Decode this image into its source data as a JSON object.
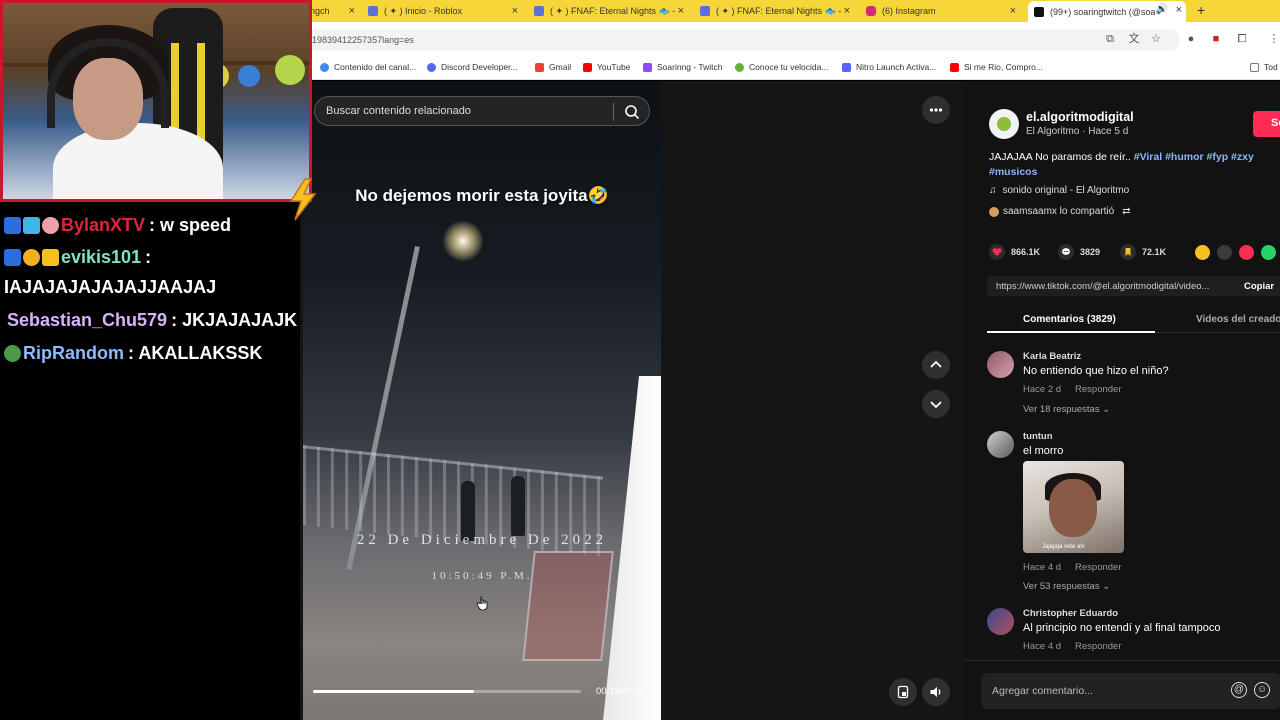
{
  "browser": {
    "tabs": [
      {
        "title": "ngch",
        "active": false
      },
      {
        "title": "( ✦ ) Inicio - Roblox",
        "active": false
      },
      {
        "title": "( ✦ ) FNAF: Eternal Nights 🐟 -",
        "active": false
      },
      {
        "title": "( ✦ ) FNAF: Eternal Nights 🐟 -",
        "active": false
      },
      {
        "title": "(6) Instagram",
        "active": false
      },
      {
        "title": "(99+) soaringtwitch (@soa",
        "active": true
      }
    ],
    "url": "19839412257357lang=es",
    "bookmarks": [
      {
        "label": "Contenido del canal...",
        "color": "#4285f4"
      },
      {
        "label": "Discord Developer...",
        "color": "#5865f2"
      },
      {
        "label": "Gmail",
        "color": "#ea4335"
      },
      {
        "label": "YouTube",
        "color": "#ff0000"
      },
      {
        "label": "Soarinng - Twitch",
        "color": "#9146ff"
      },
      {
        "label": "Conoce tu velocida...",
        "color": "#5fb236"
      },
      {
        "label": "Nitro Launch Activa...",
        "color": "#5865f2"
      },
      {
        "label": "Si me Rio, Compro...",
        "color": "#ff0000"
      },
      {
        "label": "Tod",
        "color": "#777777"
      }
    ]
  },
  "tiktok": {
    "search_placeholder": "Buscar contenido relacionado",
    "video": {
      "caption": "No dejemos morir esta joyita🤣",
      "date_overlay": "22 De Diciembre De 2022",
      "time_overlay": "10:50:49 P.M.",
      "timer": "00:15/00:25",
      "progress_fraction": 0.6
    },
    "author": {
      "username": "el.algoritmodigital",
      "subline": "El Algoritmo · Hace 5 d",
      "follow_label": "Se"
    },
    "description": {
      "text": "JAJAJAA No paramos de reír.. ",
      "tags": [
        "#Viral",
        "#humor",
        "#fyp",
        "#zxy",
        "#musicos"
      ]
    },
    "music": "sonido original - El Algoritmo",
    "shared_by": "saamsaamx lo compartió",
    "stats": {
      "likes": "866.1K",
      "comments": "3829",
      "saves": "72.1K"
    },
    "link": {
      "url": "https://www.tiktok.com/@el.algoritmodigital/video...",
      "copy_label": "Copiar"
    },
    "comment_tabs": {
      "comments": "Comentarios (3829)",
      "creator_videos": "Videos del creador"
    },
    "comments": [
      {
        "author": "Karla Beatriz",
        "text": "No entiendo que hizo el niño?",
        "time": "Hace 2 d",
        "reply": "Responder",
        "more": "Ver 18 respuestas ⌄"
      },
      {
        "author": "tuntun",
        "text": "el morro",
        "time": "Hace 4 d",
        "reply": "Responder",
        "more": "Ver 53 respuestas ⌄",
        "image_caption": "Jajajaja vete alv"
      },
      {
        "author": "Christopher Eduardo",
        "text": "Al principio no entendí y al final tampoco",
        "time": "Hace 4 d",
        "reply": "Responder"
      }
    ],
    "comment_input_placeholder": "Agregar comentario..."
  },
  "stream_chat": [
    {
      "user": "BylanXTV",
      "user_color": "#e0243b",
      "message": ": w speed"
    },
    {
      "user": "evikis101",
      "user_color": "#7fe5b8",
      "message": ":"
    },
    {
      "user": "",
      "user_color": "#ffffff",
      "message": "IAJAJAJAJAJAJJAAJAJ"
    },
    {
      "user": "Sebastian_Chu579",
      "user_color": "#d7b3ff",
      "message": ": JKJAJAJAJK"
    },
    {
      "user": "RipRandom",
      "user_color": "#8fb9ff",
      "message": ": AKALLAKSSK"
    }
  ],
  "colors": {
    "tabbar": "#f7d63a",
    "tiktok_red": "#fe2c55",
    "webcam_border": "#c8192a"
  }
}
